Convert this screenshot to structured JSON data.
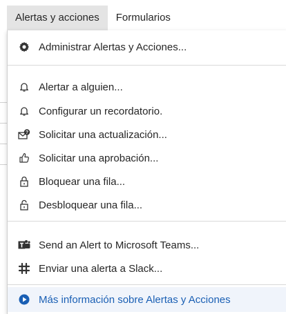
{
  "tabs": [
    {
      "label": "Alertas y acciones",
      "active": true
    },
    {
      "label": "Formularios",
      "active": false
    }
  ],
  "menu": {
    "manage": {
      "label": "Administrar Alertas y Acciones...",
      "icon": "gear-icon"
    },
    "alert_someone": {
      "label": "Alertar a alguien...",
      "icon": "bell-icon"
    },
    "reminder": {
      "label": "Configurar un recordatorio.",
      "icon": "bell-icon"
    },
    "update_request": {
      "label": "Solicitar una actualización...",
      "icon": "envelope-question-icon"
    },
    "approval": {
      "label": "Solicitar una aprobación...",
      "icon": "thumbs-up-icon"
    },
    "lock_row": {
      "label": "Bloquear una fila...",
      "icon": "lock-icon"
    },
    "unlock_row": {
      "label": "Desbloquear una fila...",
      "icon": "unlock-icon"
    },
    "teams": {
      "label": "Send an Alert to Microsoft Teams...",
      "icon": "microsoft-teams-icon"
    },
    "slack": {
      "label": "Enviar una alerta a Slack...",
      "icon": "slack-icon"
    },
    "learn_more": {
      "label": "Más información sobre Alertas y Acciones",
      "icon": "play-circle-icon"
    }
  },
  "colors": {
    "active_tab_bg": "#e4e4e4",
    "link_blue": "#1a5fb4",
    "text": "#262626"
  }
}
